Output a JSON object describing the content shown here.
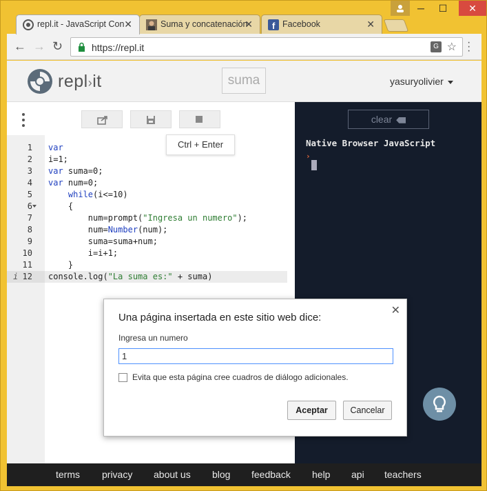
{
  "browser": {
    "tabs": [
      {
        "title": "repl.it - JavaScript Con",
        "active": true
      },
      {
        "title": "Suma y concatenación",
        "active": false
      },
      {
        "title": "Facebook",
        "active": false
      }
    ],
    "url": "https://repl.it"
  },
  "site": {
    "logo_text": "repl",
    "logo_suffix": "it",
    "project_title": "suma",
    "username": "yasuryolivier"
  },
  "editor": {
    "tooltip": "Ctrl + Enter",
    "line_numbers": [
      "1",
      "2",
      "3",
      "4",
      "5",
      "6",
      "7",
      "8",
      "9",
      "10",
      "11",
      "12"
    ],
    "active_line_marker": "i",
    "lines": [
      {
        "kw": "var",
        "rest": ""
      },
      {
        "kw": "",
        "rest": "i=1;"
      },
      {
        "kw": "var",
        "rest": " suma=0;"
      },
      {
        "kw": "var",
        "rest": " num=0;"
      },
      {
        "kw": "    while",
        "rest": "(i<=10)"
      },
      {
        "kw": "",
        "rest": "    {"
      },
      {
        "kw": "",
        "rest": "        num=prompt(",
        "str": "\"Ingresa un numero\"",
        "tail": ");"
      },
      {
        "kw": "",
        "rest": "        num=",
        "kw2": "Number",
        "tail": "(num);"
      },
      {
        "kw": "",
        "rest": "        suma=suma+num;"
      },
      {
        "kw": "",
        "rest": "        i=i+1;"
      },
      {
        "kw": "",
        "rest": "    }"
      },
      {
        "kw": "",
        "rest": "console.log(",
        "str": "\"La suma es:\"",
        "tail": " + suma)"
      }
    ]
  },
  "console": {
    "clear_label": "clear",
    "output": "Native Browser JavaScript",
    "prompt": "›"
  },
  "footer": {
    "links": [
      "terms",
      "privacy",
      "about us",
      "blog",
      "feedback",
      "help",
      "api",
      "teachers"
    ]
  },
  "dialog": {
    "title": "Una página insertada en este sitio web dice:",
    "message": "Ingresa un numero",
    "input_value": "1",
    "checkbox_label": "Evita que esta página cree cuadros de diálogo adicionales.",
    "accept_label": "Aceptar",
    "cancel_label": "Cancelar"
  },
  "colors": {
    "console_bg": "#141c2b",
    "footer_bg": "#1f1f1f",
    "keyword": "#1f3fbf",
    "string": "#2e7d32"
  }
}
